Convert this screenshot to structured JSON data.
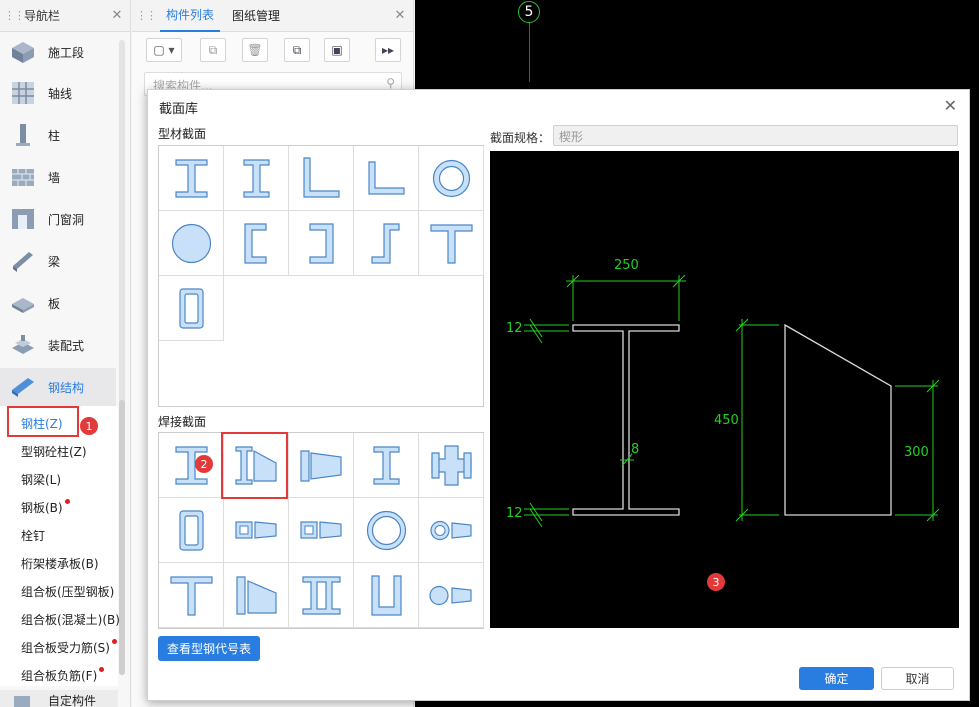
{
  "nav": {
    "title": "导航栏",
    "items": [
      {
        "label": "施工段",
        "icon": "construction-segment-icon"
      },
      {
        "label": "轴线",
        "icon": "axis-grid-icon"
      },
      {
        "label": "柱",
        "icon": "column-icon"
      },
      {
        "label": "墙",
        "icon": "wall-icon"
      },
      {
        "label": "门窗洞",
        "icon": "door-window-icon"
      },
      {
        "label": "梁",
        "icon": "beam-icon"
      },
      {
        "label": "板",
        "icon": "slab-icon"
      },
      {
        "label": "装配式",
        "icon": "prefab-icon"
      },
      {
        "label": "钢结构",
        "icon": "steel-structure-icon"
      }
    ],
    "sub_items": [
      {
        "label": "钢柱(Z)",
        "dot": false
      },
      {
        "label": "型钢砼柱(Z)",
        "dot": false
      },
      {
        "label": "钢梁(L)",
        "dot": false
      },
      {
        "label": "钢板(B)",
        "dot": true
      },
      {
        "label": "栓钉",
        "dot": false
      },
      {
        "label": "桁架楼承板(B)",
        "dot": false
      },
      {
        "label": "组合板(压型钢板)",
        "dot": false
      },
      {
        "label": "组合板(混凝土)(B)",
        "dot": false
      },
      {
        "label": "组合板受力筋(S)",
        "dot": true
      },
      {
        "label": "组合板负筋(F)",
        "dot": true
      }
    ],
    "bottom_item": "自定构件"
  },
  "components": {
    "tabs": [
      "构件列表",
      "图纸管理"
    ],
    "search_placeholder": "搜索构件..."
  },
  "canvas": {
    "axis_label": "5"
  },
  "dialog": {
    "title": "截面库",
    "profile_section_title": "型材截面",
    "welded_section_title": "焊接截面",
    "spec_label": "截面规格：",
    "spec_value": "楔形",
    "view_codes_button": "查看型钢代号表",
    "ok_button": "确定",
    "cancel_button": "取消"
  },
  "preview": {
    "dim_width": "250",
    "dim_flange_top": "12",
    "dim_flange_bottom": "12",
    "dim_web": "8",
    "dim_height_left": "450",
    "dim_height_right": "300"
  },
  "badges": [
    "1",
    "2",
    "3"
  ],
  "colors": {
    "accent": "#2a7de0",
    "highlight": "#e23a3a",
    "dim_green": "#22d022",
    "shape_fill": "#c8e0f8",
    "shape_stroke": "#4a86c6"
  }
}
